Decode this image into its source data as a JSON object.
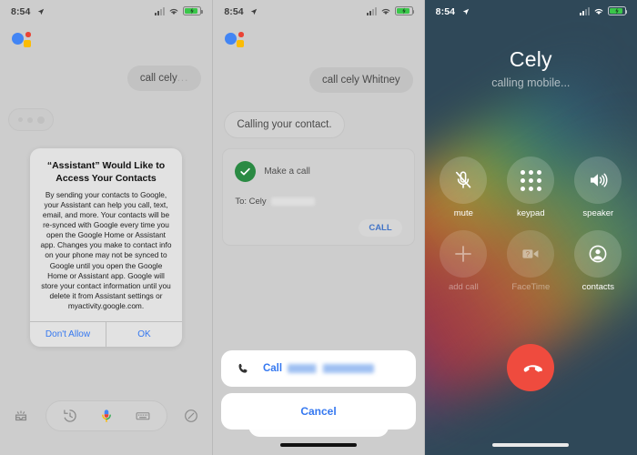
{
  "panels": {
    "assistant_permission": {
      "status_bar": {
        "time": "8:54",
        "icons": [
          "location-arrow",
          "signal-bars",
          "wifi",
          "battery-charging"
        ]
      },
      "logo": "google-assistant-logo",
      "user_message": {
        "text": "call cely",
        "trailing_dots": "..."
      },
      "typing_indicator": "assistant-typing",
      "dialog": {
        "title": "“Assistant” Would Like to Access Your Contacts",
        "message": "By sending your contacts to Google, your Assistant can help you call, text, email, and more. Your contacts will be re-synced with Google every time you open the Google Home or Assistant app. Changes you make to contact info on your phone may not be synced to Google until you open the Google Home or Assistant app. Google will store your contact information until you delete it from Assistant settings or myactivity.google.com.",
        "deny_label": "Don't Allow",
        "allow_label": "OK"
      },
      "toolbar": {
        "inbox_icon": "inbox-icon",
        "history_icon": "history-clock-icon",
        "mic_icon": "microphone-icon",
        "keyboard_icon": "keyboard-icon",
        "explore_icon": "explore-compass-icon"
      }
    },
    "assistant_call_card": {
      "status_bar": {
        "time": "8:54"
      },
      "logo": "google-assistant-logo",
      "user_message": {
        "text": "call cely Whitney"
      },
      "assistant_message": {
        "text": "Calling your contact."
      },
      "card": {
        "status_icon": "green-check-icon",
        "title": "Make a call",
        "to_label": "To: Cely",
        "to_redacted": true,
        "cta_label": "CALL"
      },
      "action_sheet": {
        "call_icon": "phone-handset-icon",
        "call_label": "Call",
        "call_redacted": true,
        "cancel_label": "Cancel"
      }
    },
    "ios_call_screen": {
      "status_bar": {
        "time": "8:54"
      },
      "callee_name": "Cely",
      "call_status": "calling mobile...",
      "controls": [
        {
          "label": "mute",
          "icon": "microphone-muted-icon",
          "dimmed": false
        },
        {
          "label": "keypad",
          "icon": "keypad-dots-icon",
          "dimmed": false
        },
        {
          "label": "speaker",
          "icon": "speaker-icon",
          "dimmed": false
        },
        {
          "label": "add call",
          "icon": "plus-icon",
          "dimmed": true
        },
        {
          "label": "FaceTime",
          "icon": "facetime-video-icon",
          "dimmed": true
        },
        {
          "label": "contacts",
          "icon": "contacts-person-icon",
          "dimmed": false
        }
      ],
      "end_call": {
        "icon": "end-call-handset-icon",
        "color": "#ef4b3e"
      }
    }
  },
  "colors": {
    "assistant_bg": "#cdcdcd",
    "call_screen_bg": "#2f4858",
    "ios_blue": "#3578f0",
    "green_check": "#2a8a43",
    "end_call_red": "#ef4b3e"
  }
}
